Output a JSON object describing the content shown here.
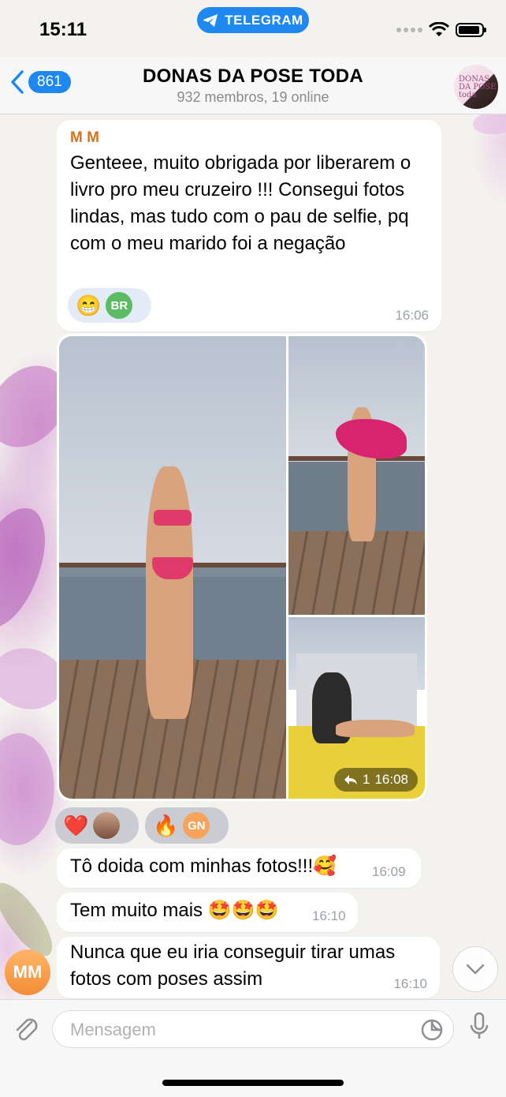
{
  "status_bar": {
    "time": "15:11",
    "app_pill": "TELEGRAM"
  },
  "header": {
    "back_count": "861",
    "title": "DONAS DA POSE TODA",
    "subtitle": "932 membros, 19 online",
    "avatar_text": "DONAS DA POSE toda"
  },
  "messages": {
    "m1": {
      "sender": "M M",
      "text": "Genteee, muito obrigada por liberarem o livro pro meu cruzeiro !!! Consegui fotos lindas, mas tudo com o pau de selfie, pq com o meu marido foi a negação",
      "reaction_emoji": "😁",
      "reaction_user": "BR",
      "time": "16:06"
    },
    "album": {
      "reply_count": "1",
      "time": "16:08",
      "reactions": [
        {
          "emoji": "❤️"
        },
        {
          "emoji": "🔥",
          "user": "GN"
        }
      ]
    },
    "m2": {
      "text": "Tô doida com minhas fotos!!!🥰",
      "time": "16:09"
    },
    "m3": {
      "text": "Tem muito mais 🤩🤩🤩",
      "time": "16:10"
    },
    "m4": {
      "text": "Nunca que eu iria conseguir tirar umas fotos com poses assim",
      "time": "16:10"
    },
    "sender_avatar": "MM"
  },
  "input": {
    "placeholder": "Mensagem"
  },
  "colors": {
    "accent": "#1e88f0",
    "sender_name": "#d7721b",
    "reaction_bg": "#e3ecf6"
  },
  "icons": [
    "telegram-icon",
    "back-chevron-icon",
    "attach-icon",
    "sticker-icon",
    "microphone-icon",
    "chevron-down-icon",
    "reply-icon",
    "wifi-icon",
    "battery-icon"
  ]
}
